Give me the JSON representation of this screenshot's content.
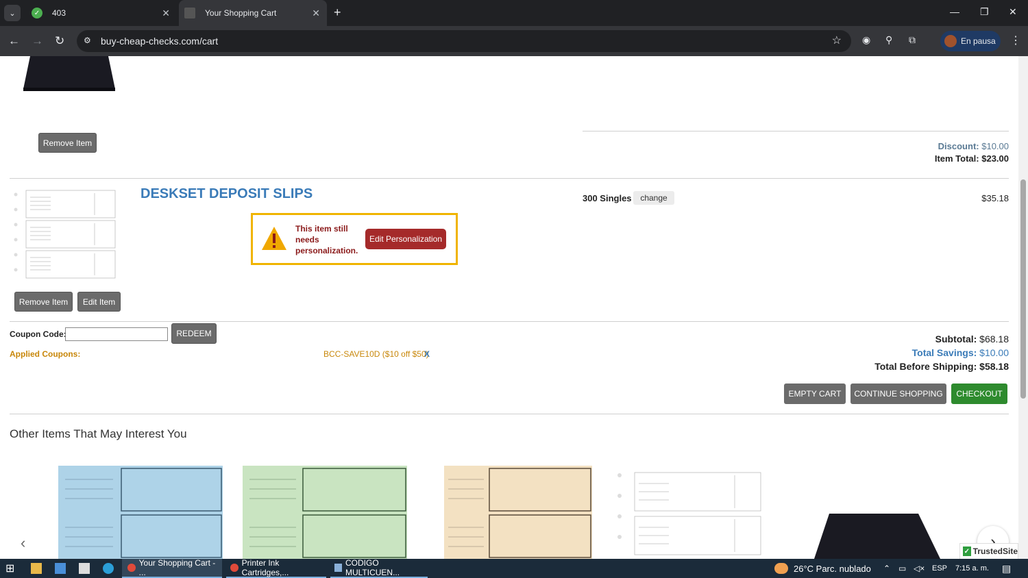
{
  "browser": {
    "tabs": [
      {
        "label": "403",
        "active": false
      },
      {
        "label": "Your Shopping Cart",
        "active": true
      }
    ],
    "url": "buy-cheap-checks.com/cart",
    "profile_label": "En pausa"
  },
  "cart": {
    "item1": {
      "remove_label": "Remove Item",
      "discount_label": "Discount:",
      "discount_value": "$10.00",
      "total_label": "Item Total:",
      "total_value": "$23.00"
    },
    "item2": {
      "title": "DESKSET DEPOSIT SLIPS",
      "quantity": "300 Singles",
      "change_label": "change",
      "price": "$35.18",
      "warning_text": "This item still needs personalization.",
      "edit_personalization_label": "Edit Personalization",
      "remove_label": "Remove Item",
      "edit_label": "Edit Item"
    },
    "coupon": {
      "label": "Coupon Code:",
      "value": "",
      "redeem_label": "REDEEM",
      "applied_label": "Applied Coupons:",
      "applied_code": "BCC-SAVE10D ($10 off $50)",
      "remove_label": "X"
    },
    "totals": {
      "subtotal_label": "Subtotal:",
      "subtotal_value": "$68.18",
      "savings_label": "Total Savings:",
      "savings_value": "$10.00",
      "before_shipping_label": "Total Before Shipping:",
      "before_shipping_value": "$58.18"
    },
    "actions": {
      "empty_label": "EMPTY CART",
      "continue_label": "CONTINUE SHOPPING",
      "checkout_label": "CHECKOUT"
    }
  },
  "recommendations": {
    "title": "Other Items That May Interest You",
    "prev_label": "‹",
    "next_label": "›"
  },
  "trusted_site": "TrustedSite",
  "taskbar": {
    "items": [
      {
        "label": "Your Shopping Cart - ..."
      },
      {
        "label": "Printer Ink Cartridges,..."
      },
      {
        "label": "CODIGO MULTICUEN..."
      }
    ],
    "weather": "26°C  Parc. nublado",
    "lang": "ESP",
    "time": "7:15 a. m."
  },
  "colors": {
    "accent_blue": "#3a7bb8",
    "warning_red": "#a52a2a",
    "checkout_green": "#2e8b2e",
    "coupon_gold": "#c8870a"
  }
}
